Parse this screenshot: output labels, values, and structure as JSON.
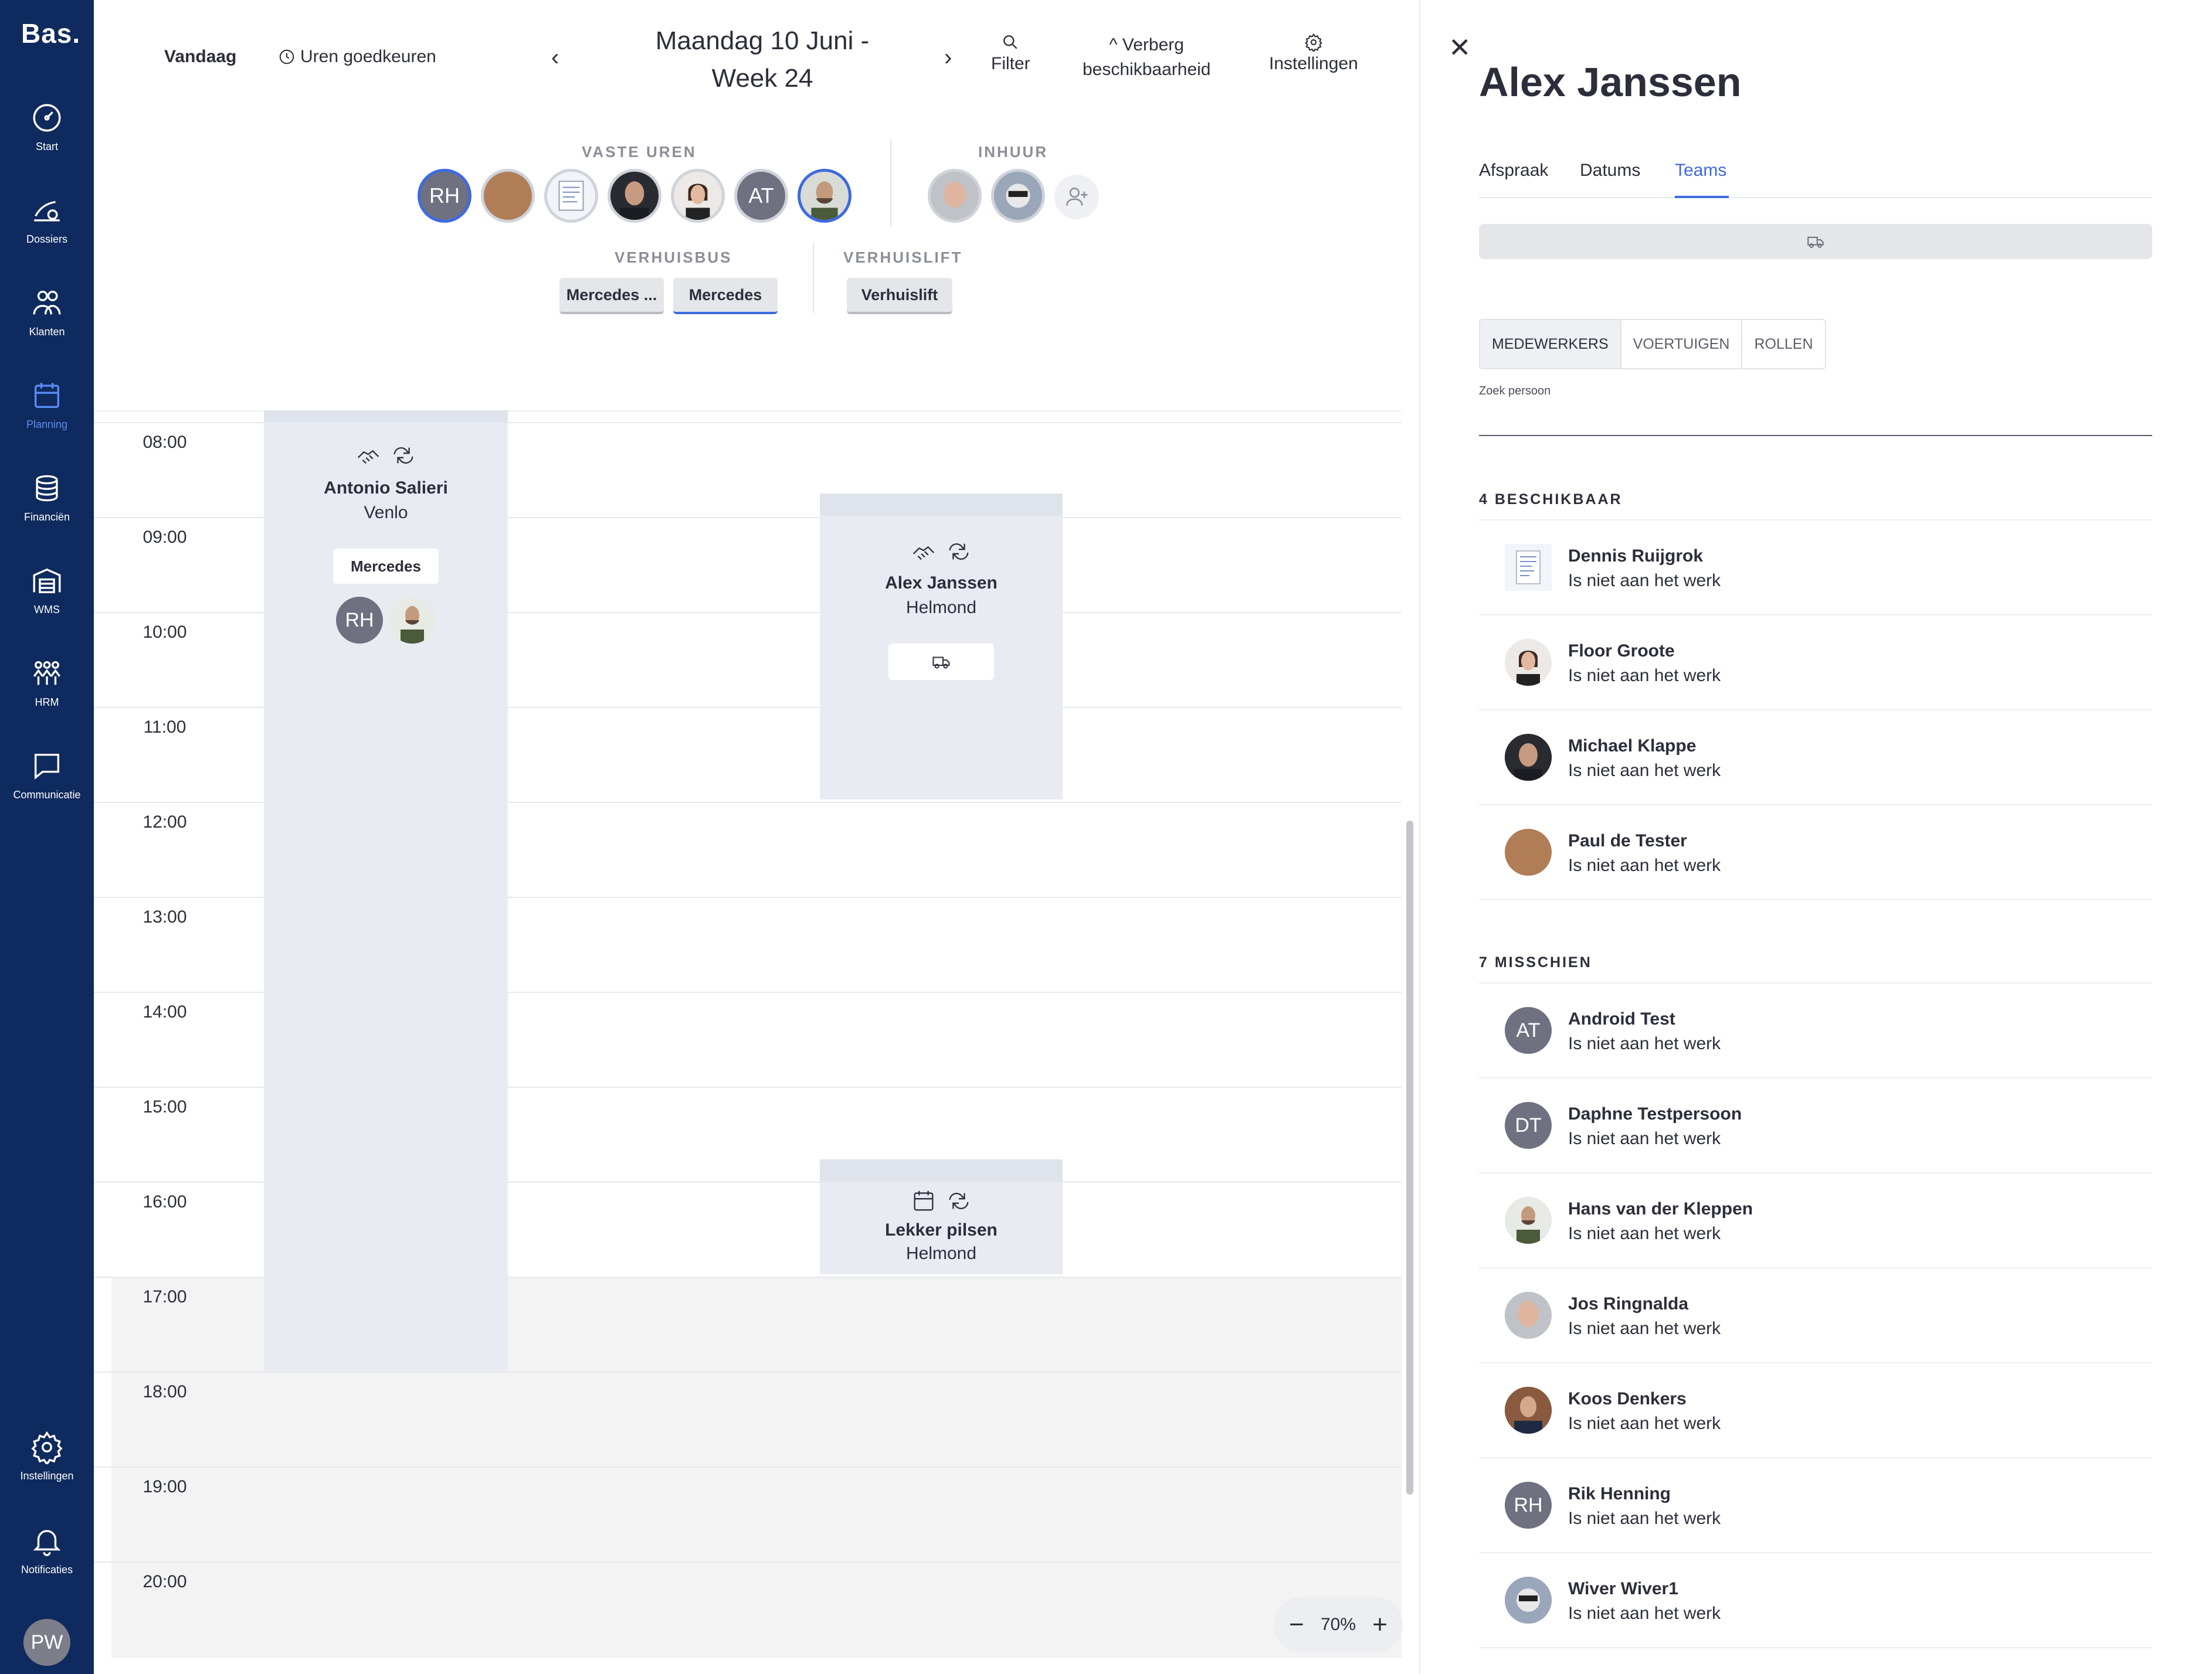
{
  "app": {
    "logo": "Bas."
  },
  "sidebar": {
    "items": [
      {
        "label": "Start",
        "icon": "gauge-icon"
      },
      {
        "label": "Dossiers",
        "icon": "dossiers-icon"
      },
      {
        "label": "Klanten",
        "icon": "customers-icon"
      },
      {
        "label": "Planning",
        "icon": "calendar-icon",
        "active": true
      },
      {
        "label": "Financiën",
        "icon": "coins-icon"
      },
      {
        "label": "WMS",
        "icon": "warehouse-icon"
      },
      {
        "label": "HRM",
        "icon": "people-icon"
      },
      {
        "label": "Communicatie",
        "icon": "chat-icon"
      }
    ],
    "bottom": [
      {
        "label": "Instellingen",
        "icon": "gear-icon"
      },
      {
        "label": "Notificaties",
        "icon": "bell-icon"
      }
    ],
    "user_initials": "PW"
  },
  "header": {
    "today": "Vandaag",
    "approve_hours": "Uren goedkeuren",
    "date_line1": "Maandag 10 Juni -",
    "date_line2": "Week 24",
    "filter": "Filter",
    "hide_line1": "Verberg",
    "hide_line2": "beschikbaarheid",
    "settings": "Instellingen"
  },
  "resources": {
    "fixed_label": "VASTE UREN",
    "hire_label": "INHUUR",
    "bus_label": "VERHUISBUS",
    "lift_label": "VERHUISLIFT",
    "fixed_initials": [
      "RH",
      "AT"
    ],
    "buses": [
      "Mercedes ...",
      "Mercedes"
    ],
    "lifts": [
      "Verhuislift"
    ]
  },
  "calendar": {
    "hours": [
      "08:00",
      "09:00",
      "10:00",
      "11:00",
      "12:00",
      "13:00",
      "14:00",
      "15:00",
      "16:00",
      "17:00",
      "18:00",
      "19:00",
      "20:00"
    ],
    "events": [
      {
        "name": "Antonio Salieri",
        "place": "Venlo",
        "vehicle": "Mercedes",
        "initials": "RH"
      },
      {
        "name": "Alex Janssen",
        "place": "Helmond"
      },
      {
        "name": "Lekker pilsen",
        "place": "Helmond"
      }
    ],
    "zoom": "70%"
  },
  "panel": {
    "title": "Alex Janssen",
    "tabs": [
      "Afspraak",
      "Datums",
      "Teams"
    ],
    "segments": [
      "MEDEWERKERS",
      "VOERTUIGEN",
      "ROLLEN"
    ],
    "search_label": "Zoek persoon",
    "available_heading": "4 BESCHIKBAAR",
    "maybe_heading": "7 MISSCHIEN",
    "available": [
      {
        "name": "Dennis Ruijgrok",
        "status": "Is niet aan het werk"
      },
      {
        "name": "Floor Groote",
        "status": "Is niet aan het werk"
      },
      {
        "name": "Michael Klappe",
        "status": "Is niet aan het werk"
      },
      {
        "name": "Paul de Tester",
        "status": "Is niet aan het werk"
      }
    ],
    "maybe": [
      {
        "name": "Android Test",
        "status": "Is niet aan het werk",
        "initials": "AT"
      },
      {
        "name": "Daphne Testpersoon",
        "status": "Is niet aan het werk",
        "initials": "DT"
      },
      {
        "name": "Hans van der Kleppen",
        "status": "Is niet aan het werk"
      },
      {
        "name": "Jos Ringnalda",
        "status": "Is niet aan het werk"
      },
      {
        "name": "Koos Denkers",
        "status": "Is niet aan het werk"
      },
      {
        "name": "Rik Henning",
        "status": "Is niet aan het werk",
        "initials": "RH"
      },
      {
        "name": "Wiver Wiver1",
        "status": "Is niet aan het werk"
      }
    ]
  },
  "colors": {
    "sidebar": "#0f2a5e",
    "accent": "#3e6ae0",
    "event_bg": "#e8ecf2"
  }
}
